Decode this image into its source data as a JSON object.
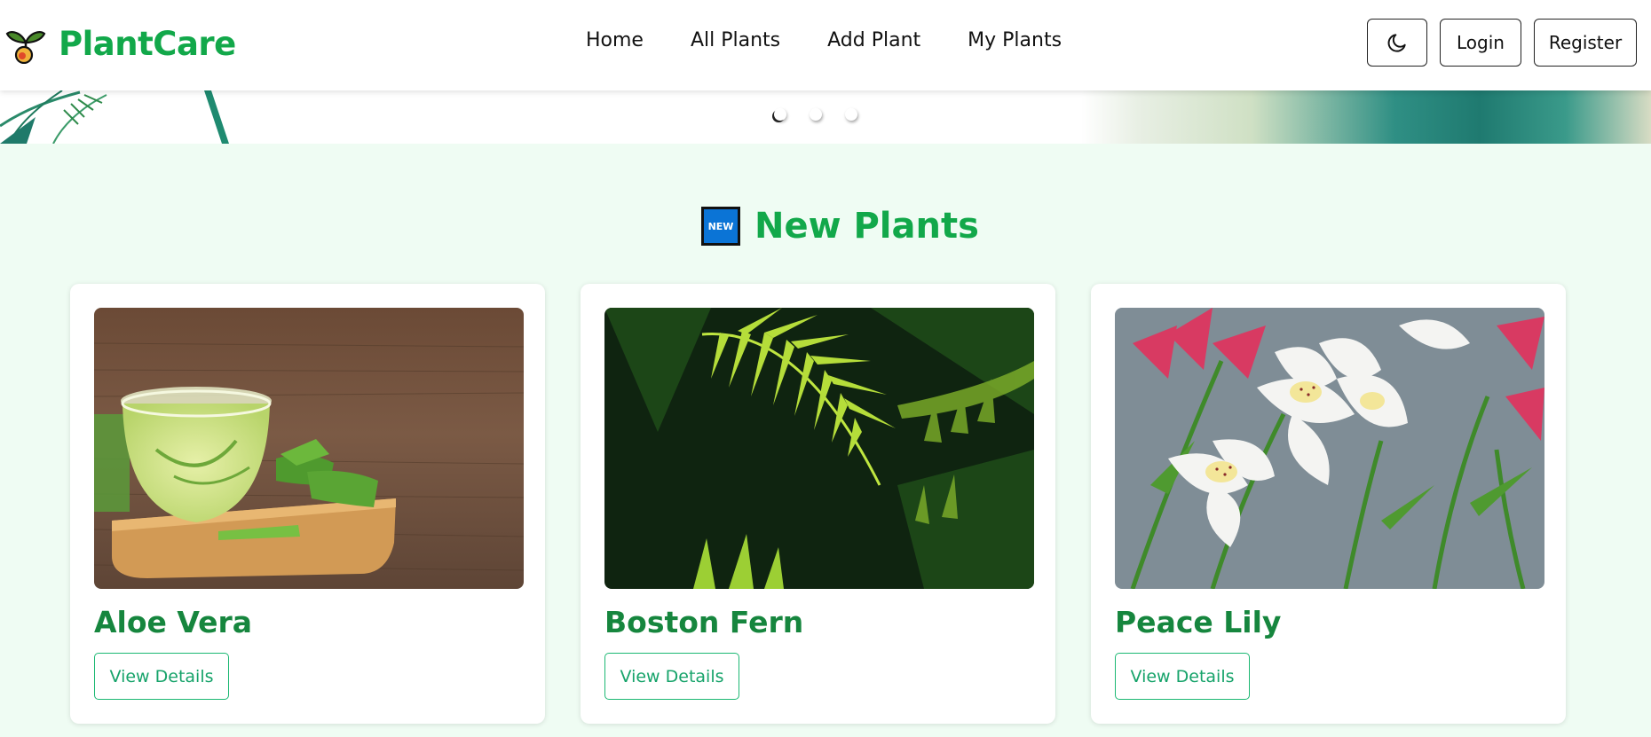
{
  "brand": {
    "name": "PlantCare",
    "logo_icon": "sprout-icon"
  },
  "nav": {
    "links": [
      "Home",
      "All Plants",
      "Add Plant",
      "My Plants"
    ],
    "theme_icon": "moon-icon",
    "login_label": "Login",
    "register_label": "Register"
  },
  "hero": {
    "slides": 3,
    "active_slide": 1
  },
  "section": {
    "badge": "NEW",
    "badge_icon": "new-badge-icon",
    "title": "New Plants"
  },
  "plants": [
    {
      "name": "Aloe Vera",
      "image": "aloe-vera-drink-image",
      "button": "View Details"
    },
    {
      "name": "Boston Fern",
      "image": "fern-leaves-image",
      "button": "View Details"
    },
    {
      "name": "Peace Lily",
      "image": "white-lily-flowers-image",
      "button": "View Details"
    }
  ],
  "colors": {
    "brand_green": "#12a84a",
    "title_green": "#16863e",
    "button_green": "#1cb873",
    "page_bg": "#effcf3",
    "badge_blue": "#0b74d6"
  }
}
